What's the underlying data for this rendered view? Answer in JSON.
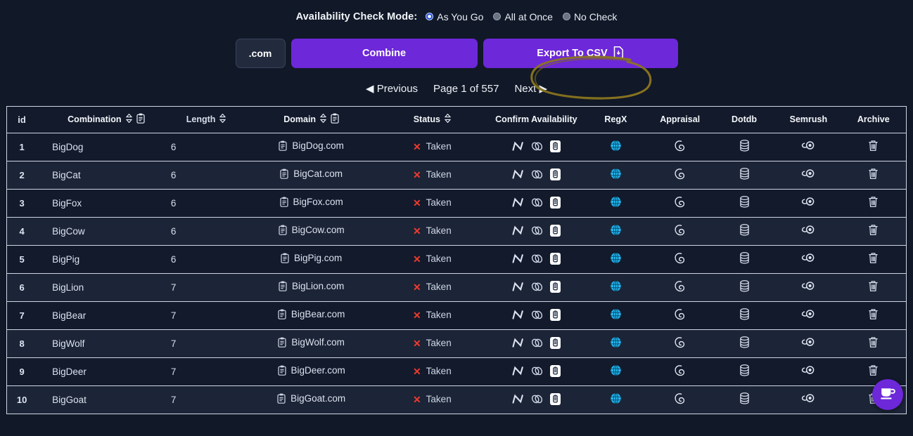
{
  "mode": {
    "label": "Availability Check Mode:",
    "options": [
      {
        "label": "As You Go",
        "checked": true
      },
      {
        "label": "All at Once",
        "checked": false
      },
      {
        "label": "No Check",
        "checked": false
      }
    ]
  },
  "actions": {
    "tld_label": ".com",
    "combine_label": "Combine",
    "export_label": "Export To CSV",
    "export_icon": "file-download-icon",
    "annotation": {
      "shape": "hand-drawn-ellipse",
      "color": "#8a7520",
      "target": "export-to-csv-button"
    }
  },
  "pagination": {
    "previous_label": "◀ Previous",
    "page_info": "Page 1 of 557",
    "next_label": "Next ▶",
    "current_page": 1,
    "total_pages": 557
  },
  "table": {
    "columns": [
      {
        "key": "id",
        "label": "id",
        "sortable": false,
        "copy": false
      },
      {
        "key": "comb",
        "label": "Combination",
        "sortable": true,
        "copy": true
      },
      {
        "key": "len",
        "label": "Length",
        "sortable": true,
        "copy": false
      },
      {
        "key": "dom",
        "label": "Domain",
        "sortable": true,
        "copy": true
      },
      {
        "key": "status",
        "label": "Status",
        "sortable": true,
        "copy": false
      },
      {
        "key": "confirm",
        "label": "Confirm Availability",
        "sortable": false,
        "copy": false
      },
      {
        "key": "regx",
        "label": "RegX",
        "sortable": false,
        "copy": false
      },
      {
        "key": "appraisal",
        "label": "Appraisal",
        "sortable": false,
        "copy": false
      },
      {
        "key": "dotdb",
        "label": "Dotdb",
        "sortable": false,
        "copy": false
      },
      {
        "key": "semrush",
        "label": "Semrush",
        "sortable": false,
        "copy": false
      },
      {
        "key": "archive",
        "label": "Archive",
        "sortable": false,
        "copy": false
      }
    ],
    "row_icons": {
      "confirm": [
        "namecheap-n-icon",
        "link-chain-icon",
        "clipboard-badge-icon"
      ],
      "regx": "globe-icon",
      "appraisal": "godaddy-swirl-icon",
      "dotdb": "database-icon",
      "semrush": "semrush-comet-icon",
      "archive": "trash-icon"
    },
    "rows": [
      {
        "id": "1",
        "combination": "BigDog",
        "length": "6",
        "domain": "BigDog.com",
        "status": "Taken"
      },
      {
        "id": "2",
        "combination": "BigCat",
        "length": "6",
        "domain": "BigCat.com",
        "status": "Taken"
      },
      {
        "id": "3",
        "combination": "BigFox",
        "length": "6",
        "domain": "BigFox.com",
        "status": "Taken"
      },
      {
        "id": "4",
        "combination": "BigCow",
        "length": "6",
        "domain": "BigCow.com",
        "status": "Taken"
      },
      {
        "id": "5",
        "combination": "BigPig",
        "length": "6",
        "domain": "BigPig.com",
        "status": "Taken"
      },
      {
        "id": "6",
        "combination": "BigLion",
        "length": "7",
        "domain": "BigLion.com",
        "status": "Taken"
      },
      {
        "id": "7",
        "combination": "BigBear",
        "length": "7",
        "domain": "BigBear.com",
        "status": "Taken"
      },
      {
        "id": "8",
        "combination": "BigWolf",
        "length": "7",
        "domain": "BigWolf.com",
        "status": "Taken"
      },
      {
        "id": "9",
        "combination": "BigDeer",
        "length": "7",
        "domain": "BigDeer.com",
        "status": "Taken"
      },
      {
        "id": "10",
        "combination": "BigGoat",
        "length": "7",
        "domain": "BigGoat.com",
        "status": "Taken"
      }
    ]
  },
  "widget": {
    "name": "buy-me-a-coffee-button",
    "icon": "coffee-cup-icon",
    "color": "#6d28d9"
  },
  "theme": {
    "page_bg": "#111827",
    "row_odd": "#121a2c",
    "row_even": "#1c2437",
    "accent_purple": "#6d28d9",
    "status_red": "#ef3b2d",
    "globe_cyan": "#22b8ef",
    "grid_line": "#cfd6e4"
  }
}
